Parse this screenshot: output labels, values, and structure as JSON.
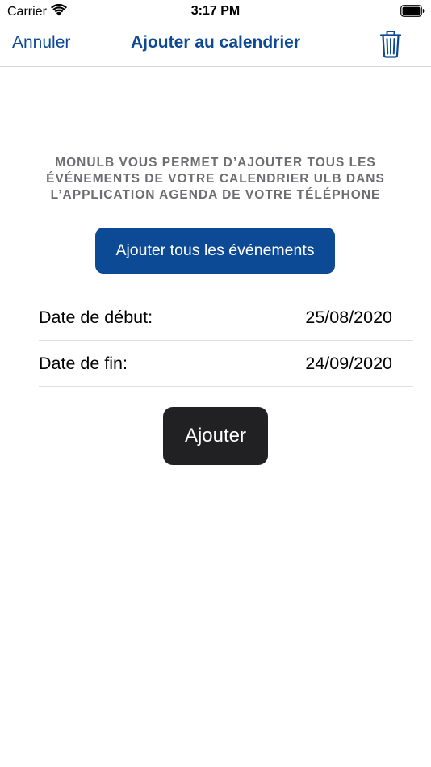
{
  "status_bar": {
    "carrier": "Carrier",
    "time": "3:17 PM",
    "icons": [
      "wifi-icon",
      "battery-icon"
    ]
  },
  "nav": {
    "cancel_label": "Annuler",
    "title": "Ajouter au calendrier",
    "trash_icon": "trash-icon"
  },
  "main": {
    "info_lines": [
      "MONULB VOUS PERMET D’AJOUTER TOUS LES",
      "ÉVÉNEMENTS DE VOTRE CALENDRIER ULB DANS",
      "L’APPLICATION AGENDA DE VOTRE TÉLÉPHONE"
    ],
    "add_all_label": "Ajouter tous les événements",
    "start": {
      "label": "Date de début:",
      "value": "25/08/2020"
    },
    "end": {
      "label": "Date de fin:",
      "value": "24/09/2020"
    },
    "add_label": "Ajouter"
  },
  "colors": {
    "accent": "#0d4a95",
    "dark_button": "#212124",
    "secondary_text": "#6d6d72",
    "separator": "#e0e0e4"
  }
}
